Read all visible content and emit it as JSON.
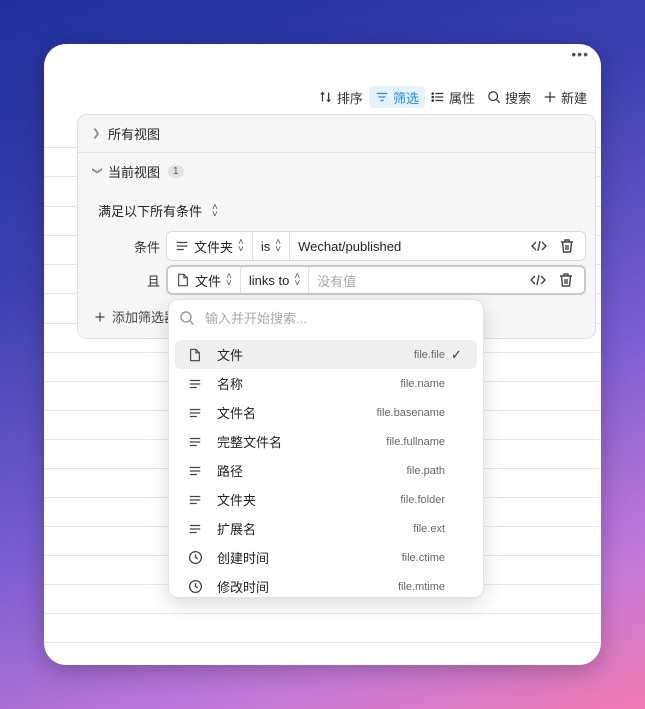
{
  "window": {
    "more_label": "•••"
  },
  "toolbar": {
    "items": [
      {
        "label": "排序",
        "icon": "sort-icon",
        "active": false
      },
      {
        "label": "筛选",
        "icon": "filter-icon",
        "active": true
      },
      {
        "label": "属性",
        "icon": "list-icon",
        "active": false
      },
      {
        "label": "搜索",
        "icon": "search-icon",
        "active": false
      },
      {
        "label": "新建",
        "icon": "plus-icon",
        "active": false
      }
    ]
  },
  "filter_panel": {
    "all_views_label": "所有视图",
    "current_view_label": "当前视图",
    "current_view_count": "1",
    "match_label": "满足以下所有条件",
    "conditions": [
      {
        "prefix": "条件",
        "property": "文件夹",
        "operator": "is",
        "value": "Wechat/published",
        "placeholder": ""
      },
      {
        "prefix": "且",
        "property": "文件",
        "operator": "links to",
        "value": "",
        "placeholder": "没有值"
      }
    ],
    "add_filter_label": "添加筛选器"
  },
  "dropdown": {
    "search_placeholder": "输入并开始搜索...",
    "items": [
      {
        "label": "文件",
        "key": "file.file",
        "icon": "file-icon",
        "selected": true
      },
      {
        "label": "名称",
        "key": "file.name",
        "icon": "text-lines-icon",
        "selected": false
      },
      {
        "label": "文件名",
        "key": "file.basename",
        "icon": "text-lines-icon",
        "selected": false
      },
      {
        "label": "完整文件名",
        "key": "file.fullname",
        "icon": "text-lines-icon",
        "selected": false
      },
      {
        "label": "路径",
        "key": "file.path",
        "icon": "text-lines-icon",
        "selected": false
      },
      {
        "label": "文件夹",
        "key": "file.folder",
        "icon": "text-lines-icon",
        "selected": false
      },
      {
        "label": "扩展名",
        "key": "file.ext",
        "icon": "text-lines-icon",
        "selected": false
      },
      {
        "label": "创建时间",
        "key": "file.ctime",
        "icon": "clock-icon",
        "selected": false
      },
      {
        "label": "修改时间",
        "key": "file.mtime",
        "icon": "clock-icon",
        "selected": false
      }
    ]
  },
  "colors": {
    "accent": "#1f8ce0"
  }
}
